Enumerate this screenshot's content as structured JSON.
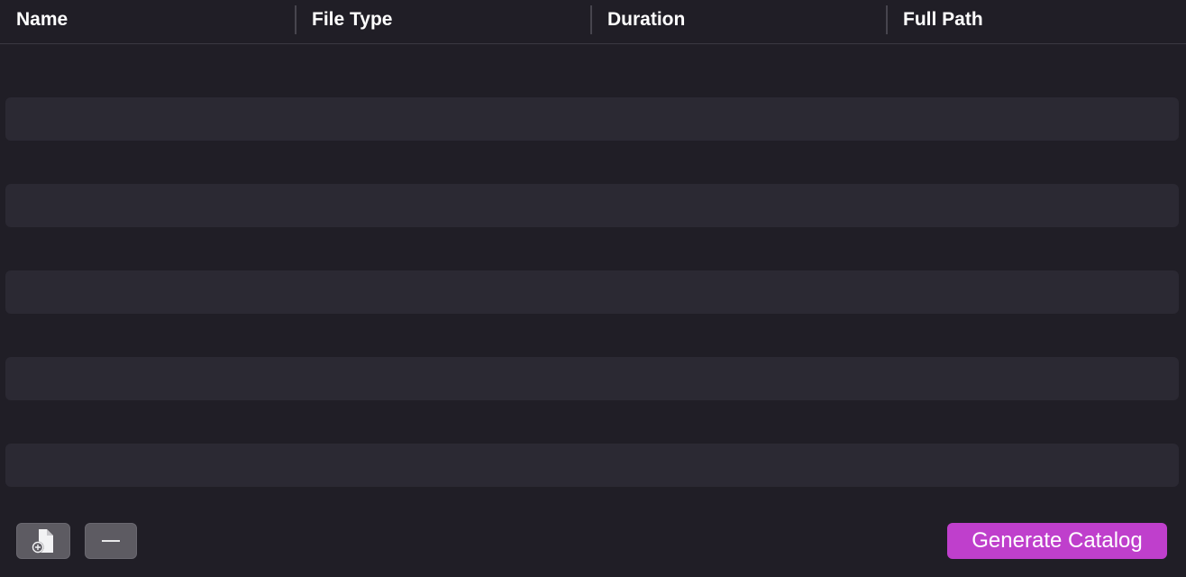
{
  "table": {
    "columns": [
      {
        "label": "Name"
      },
      {
        "label": "File Type"
      },
      {
        "label": "Duration"
      },
      {
        "label": "Full Path"
      }
    ],
    "rows": []
  },
  "footer": {
    "add_icon": "add-document-icon",
    "remove_icon": "minus-icon",
    "generate_label": "Generate Catalog"
  },
  "colors": {
    "background": "#201e26",
    "stripe": "#2b2933",
    "accent": "#bf3fcc",
    "button": "#5d5b62"
  }
}
